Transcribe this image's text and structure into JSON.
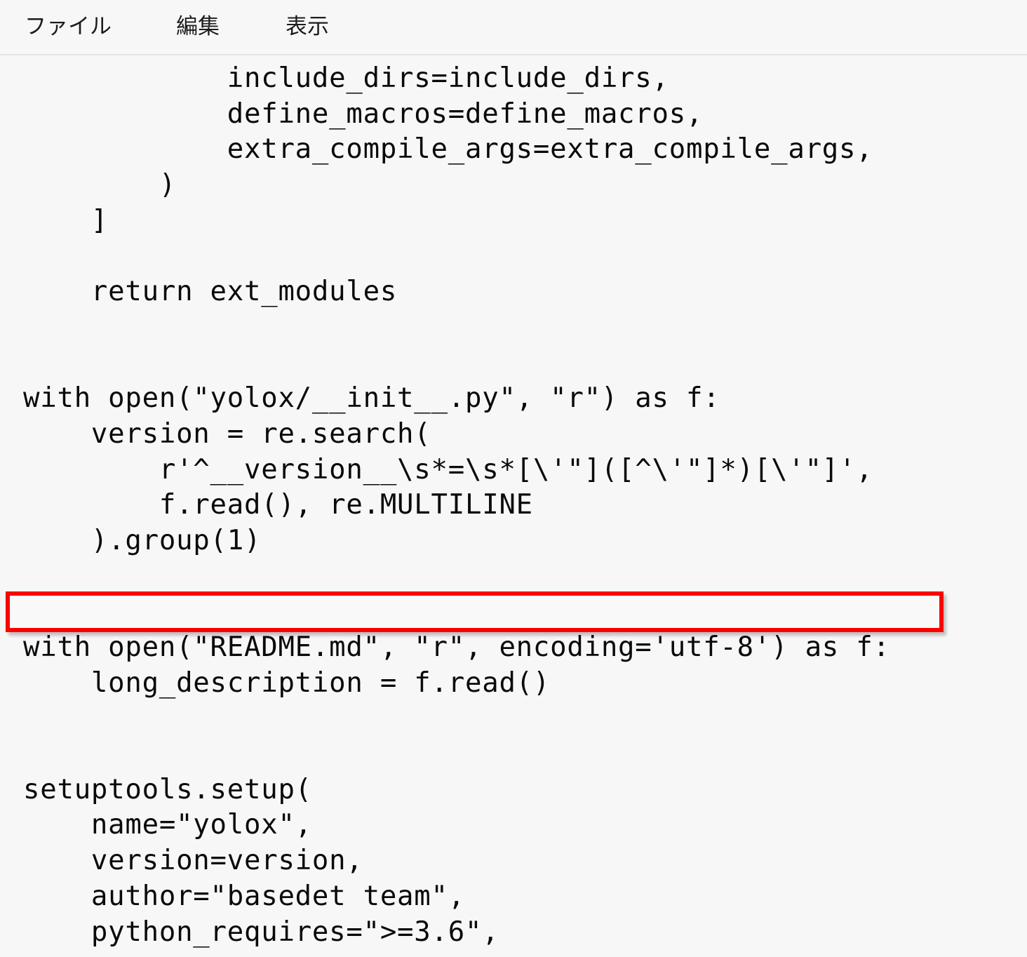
{
  "window": {
    "background_color": "#f7f7f7",
    "text_color": "#0a0a0a"
  },
  "menubar": {
    "items": [
      {
        "label": "ファイル",
        "name": "file"
      },
      {
        "label": "編集",
        "name": "edit"
      },
      {
        "label": "表示",
        "name": "view"
      }
    ]
  },
  "editor": {
    "language": "python",
    "highlight_color": "#fc0000",
    "highlighted_line_index": 15,
    "lines": [
      "            include_dirs=include_dirs,",
      "            define_macros=define_macros,",
      "            extra_compile_args=extra_compile_args,",
      "        )",
      "    ]",
      "",
      "    return ext_modules",
      "",
      "",
      "with open(\"yolox/__init__.py\", \"r\") as f:",
      "    version = re.search(",
      "        r'^__version__\\s*=\\s*[\\'\"]([^\\'\"]*)[\\'\"]',",
      "        f.read(), re.MULTILINE",
      "    ).group(1)",
      "",
      "",
      "with open(\"README.md\", \"r\", encoding='utf-8') as f:",
      "    long_description = f.read()",
      "",
      "",
      "setuptools.setup(",
      "    name=\"yolox\",",
      "    version=version,",
      "    author=\"basedet team\",",
      "    python_requires=\">=3.6\","
    ]
  }
}
